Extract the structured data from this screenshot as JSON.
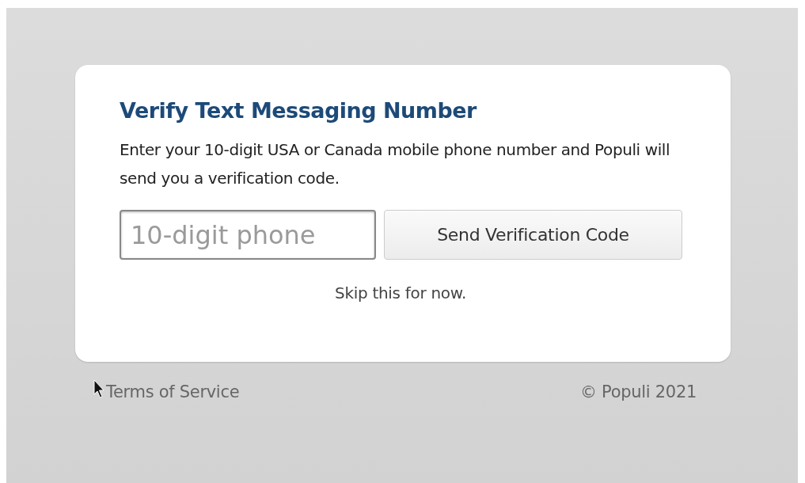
{
  "card": {
    "title": "Verify Text Messaging Number",
    "description": "Enter your 10-digit USA or Canada mobile phone number and Populi will send you a verification code.",
    "phone_field": {
      "placeholder": "10-digit phone"
    },
    "send_button": "Send Verification Code",
    "skip_link": "Skip this for now."
  },
  "footer": {
    "terms_link": "Terms of Service",
    "copyright": "© Populi 2021"
  }
}
